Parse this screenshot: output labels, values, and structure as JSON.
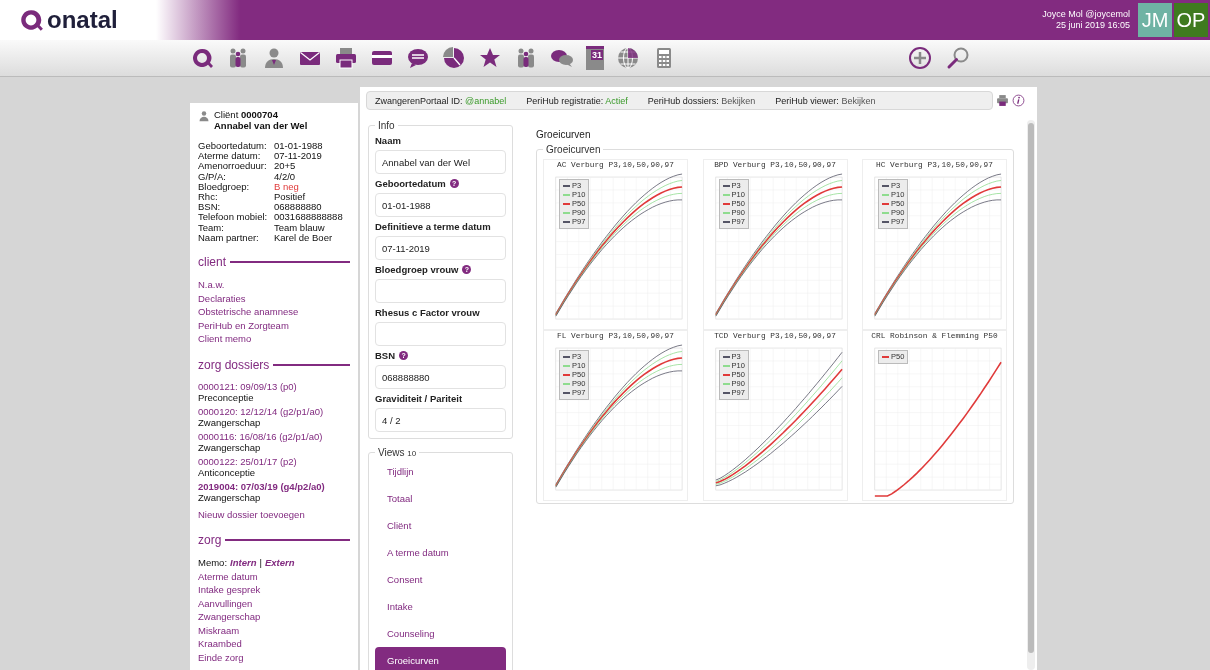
{
  "header": {
    "logo": "onatal",
    "user": "Joyce Mol @joycemol",
    "datetime": "25 juni 2019 16:05",
    "avatars": [
      {
        "initials": "JM",
        "color": "#6fb3a4"
      },
      {
        "initials": "OP",
        "color": "#3f7a1f"
      }
    ]
  },
  "toolbar": {
    "calendar_day": "31"
  },
  "client": {
    "label": "Cliënt",
    "id": "0000704",
    "name": "Annabel van der Wel",
    "fields": [
      {
        "label": "Geboortedatum:",
        "value": "01-01-1988",
        "alert": false
      },
      {
        "label": "Aterme datum:",
        "value": "07-11-2019",
        "alert": false
      },
      {
        "label": "Amenorroeduur:",
        "value": "20+5",
        "alert": false
      },
      {
        "label": "G/P/A:",
        "value": "4/2/0",
        "alert": false
      },
      {
        "label": "Bloedgroep:",
        "value": "B neg",
        "alert": true
      },
      {
        "label": "Rhc:",
        "value": "Positief",
        "alert": false
      },
      {
        "label": "BSN:",
        "value": "068888880",
        "alert": false
      },
      {
        "label": "Telefoon mobiel:",
        "value": "0031688888888",
        "alert": false
      },
      {
        "label": "Team:",
        "value": "Team blauw",
        "alert": false
      },
      {
        "label": "Naam partner:",
        "value": "Karel de Boer",
        "alert": false
      }
    ]
  },
  "sidebar": {
    "sections": [
      {
        "title": "client",
        "kind": "links",
        "links": [
          "N.a.w.",
          "Declaraties",
          "Obstetrische anamnese",
          "PeriHub en Zorgteam",
          "Client memo"
        ]
      },
      {
        "title": "zorg dossiers",
        "kind": "dossiers",
        "dossiers": [
          {
            "link": "0000121: 09/09/13 (p0)",
            "type": "Preconceptie",
            "current": false
          },
          {
            "link": "0000120: 12/12/14 (g2/p1/a0)",
            "type": "Zwangerschap",
            "current": false
          },
          {
            "link": "0000116: 16/08/16 (g2/p1/a0)",
            "type": "Zwangerschap",
            "current": false
          },
          {
            "link": "0000122: 25/01/17 (p2)",
            "type": "Anticonceptie",
            "current": false
          },
          {
            "link": "2019004: 07/03/19 (g4/p2/a0)",
            "type": "Zwangerschap",
            "current": true
          }
        ],
        "links": [
          "Nieuw dossier toevoegen"
        ]
      },
      {
        "title": "zorg",
        "kind": "memo",
        "memo": {
          "label": "Memo:",
          "options": [
            "Intern",
            "Extern"
          ],
          "separator": "|"
        },
        "links": [
          "Aterme datum",
          "Intake gesprek",
          "Aanvullingen",
          "Zwangerschap",
          "Miskraam",
          "Kraambed",
          "Einde zorg"
        ]
      }
    ]
  },
  "info_bar": [
    {
      "label": "ZwangerenPortaal ID:",
      "value": "@annabel",
      "kind": "status"
    },
    {
      "label": "PeriHub registratie:",
      "value": "Actief",
      "kind": "status"
    },
    {
      "label": "PeriHub dossiers:",
      "value": "Bekijken",
      "kind": "link"
    },
    {
      "label": "PeriHub viewer:",
      "value": "Bekijken",
      "kind": "link"
    }
  ],
  "info": {
    "legend": "Info",
    "fields": [
      {
        "label": "Naam",
        "value": "Annabel van der Wel"
      },
      {
        "label": "Geboortedatum",
        "value": "01-01-1988",
        "help_icon": "?"
      },
      {
        "label": "Definitieve a terme datum",
        "value": "07-11-2019"
      },
      {
        "label": "Bloedgroep vrouw",
        "help_icon": "?"
      },
      {
        "label": "Rhesus c Factor vrouw"
      },
      {
        "label": "BSN",
        "value": "068888880",
        "help_icon": "?"
      },
      {
        "label": "Graviditeit / Pariteit",
        "value": "4 / 2"
      }
    ]
  },
  "views": {
    "legend": "Views",
    "count": "10",
    "items": [
      {
        "label": "Tijdlijn",
        "selected": false
      },
      {
        "label": "Totaal",
        "selected": false
      },
      {
        "label": "Cliënt",
        "selected": false
      },
      {
        "label": "A terme datum",
        "selected": false
      },
      {
        "label": "Consent",
        "selected": false
      },
      {
        "label": "Intake",
        "selected": false
      },
      {
        "label": "Counseling",
        "selected": false
      },
      {
        "label": "Groeicurven",
        "selected": true
      }
    ]
  },
  "content": {
    "heading": "Groeicurven",
    "legend": "Groeicurven",
    "charts": [
      {
        "title": "AC Verburg P3,10,50,90,97",
        "legend": [
          {
            "label": "P3",
            "color": "#555566"
          },
          {
            "label": "P10",
            "color": "#8fdc8f"
          },
          {
            "label": "P50",
            "color": "#e03a3a"
          },
          {
            "label": "P90",
            "color": "#8fdc8f"
          },
          {
            "label": "P97",
            "color": "#555566"
          }
        ]
      },
      {
        "title": "BPD Verburg P3,10,50,90,97",
        "legend": [
          {
            "label": "P3",
            "color": "#555566"
          },
          {
            "label": "P10",
            "color": "#8fdc8f"
          },
          {
            "label": "P50",
            "color": "#e03a3a"
          },
          {
            "label": "P90",
            "color": "#8fdc8f"
          },
          {
            "label": "P97",
            "color": "#555566"
          }
        ]
      },
      {
        "title": "HC Verburg P3,10,50,90,97",
        "legend": [
          {
            "label": "P3",
            "color": "#555566"
          },
          {
            "label": "P10",
            "color": "#8fdc8f"
          },
          {
            "label": "P50",
            "color": "#e03a3a"
          },
          {
            "label": "P90",
            "color": "#8fdc8f"
          },
          {
            "label": "P97",
            "color": "#555566"
          }
        ]
      },
      {
        "title": "FL Verburg P3,10,50,90,97",
        "legend": [
          {
            "label": "P3",
            "color": "#555566"
          },
          {
            "label": "P10",
            "color": "#8fdc8f"
          },
          {
            "label": "P50",
            "color": "#e03a3a"
          },
          {
            "label": "P90",
            "color": "#8fdc8f"
          },
          {
            "label": "P97",
            "color": "#555566"
          }
        ]
      },
      {
        "title": "TCD Verburg P3,10,50,90,97",
        "legend": [
          {
            "label": "P3",
            "color": "#555566"
          },
          {
            "label": "P10",
            "color": "#8fdc8f"
          },
          {
            "label": "P50",
            "color": "#e03a3a"
          },
          {
            "label": "P90",
            "color": "#8fdc8f"
          },
          {
            "label": "P97",
            "color": "#555566"
          }
        ]
      },
      {
        "title": "CRL Robinson & Flemming P50",
        "legend": [
          {
            "label": "P50",
            "color": "#e03a3a"
          }
        ]
      }
    ]
  }
}
